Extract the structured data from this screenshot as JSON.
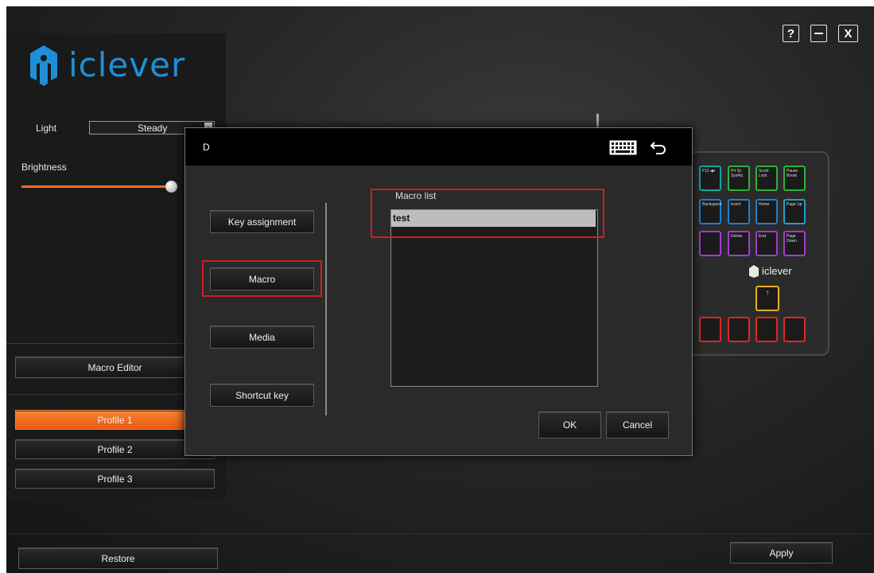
{
  "brand": {
    "name": "iclever",
    "logo_icon": "iclever-logo-icon"
  },
  "window_controls": {
    "help": "?",
    "minimize": "—",
    "close": "X"
  },
  "sidebar": {
    "light_label": "Light",
    "light_value": "Steady",
    "brightness_label": "Brightness",
    "brightness_level": 1.0,
    "macro_editor": "Macro Editor",
    "profiles": [
      "Profile 1",
      "Profile 2",
      "Profile 3"
    ],
    "active_profile": 0
  },
  "footer": {
    "restore": "Restore",
    "apply": "Apply"
  },
  "dialog": {
    "title": "D",
    "icons": [
      "keyboard-icon",
      "undo-icon"
    ],
    "menu": [
      "Key assignment",
      "Macro",
      "Media",
      "Shortcut key"
    ],
    "selected_menu": "Macro",
    "macro_list_label": "Macro list",
    "macro_items": [
      "test"
    ],
    "ok": "OK",
    "cancel": "Cancel"
  },
  "keyboard_preview": {
    "keys_row1": [
      "F12 ◀+",
      "Prt Sc SysRq",
      "Scroll Lock",
      "Pause Break"
    ],
    "keys_row2": [
      "Backspace",
      "Insert",
      "Home",
      "Page Up"
    ],
    "keys_row3": [
      "",
      "Delete",
      "End",
      "Page Down"
    ],
    "logo_text": "iclever"
  },
  "colors": {
    "accent": "#f46a1f",
    "highlight_box": "#d01e1e"
  }
}
